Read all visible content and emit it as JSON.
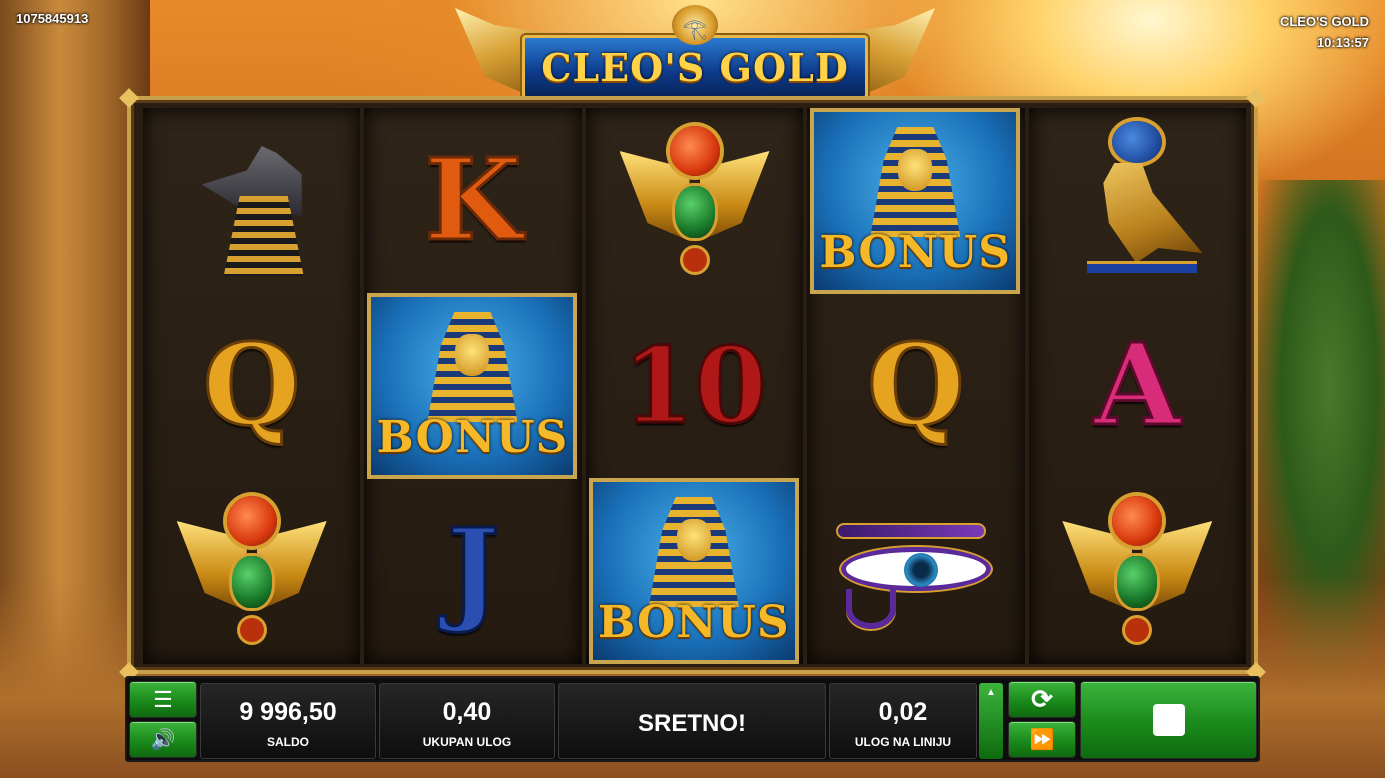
{
  "header": {
    "session_id": "1075845913",
    "game_name": "CLEO'S GOLD",
    "clock": "10:13:57",
    "logo_text": "CLEO'S GOLD",
    "logo_eye_glyph": "𓂀"
  },
  "reels": [
    [
      "anubis",
      "Q",
      "scarab"
    ],
    [
      "K",
      "BONUS",
      "J"
    ],
    [
      "scarab",
      "10",
      "BONUS"
    ],
    [
      "BONUS",
      "Q",
      "eye-of-horus"
    ],
    [
      "horus",
      "A",
      "scarab"
    ]
  ],
  "symbols": {
    "k": "K",
    "q": "Q",
    "ten": "10",
    "a": "A",
    "j": "J",
    "bonus": "BONUS"
  },
  "controls": {
    "menu_icon": "☰",
    "sound_icon": "🔊",
    "balance_value": "9 996,50",
    "balance_label": "SALDO",
    "total_bet_value": "0,40",
    "total_bet_label": "UKUPAN ULOG",
    "message": "SRETNO!",
    "line_bet_value": "0,02",
    "line_bet_label": "ULOG NA LINIJU",
    "bet_up_icon": "▲",
    "autoplay_icon": "⟳",
    "turbo_icon": "⏩",
    "spin_icon": "stop-square-icon"
  },
  "colors": {
    "button_green": "#1a8a1a",
    "frame_gold": "#c9a04a",
    "bonus_blue": "#1a70b8"
  }
}
